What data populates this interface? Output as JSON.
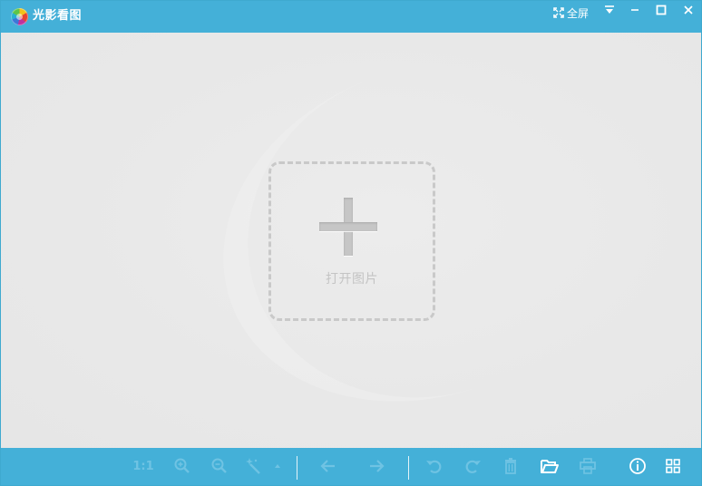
{
  "window": {
    "title": "光影看图"
  },
  "titlebar": {
    "fullscreen_label": "全屏",
    "icons": [
      "fullscreen-icon",
      "menu-icon",
      "minimize-icon",
      "maximize-icon",
      "close-icon"
    ]
  },
  "content": {
    "open_label": "打开图片",
    "open_icon": "plus-icon"
  },
  "toolbar": {
    "actual_size_label": "1:1",
    "icons": [
      "zoom-in-icon",
      "zoom-out-icon",
      "magic-wand-icon",
      "dropdown-arrow-icon",
      "prev-arrow-icon",
      "next-arrow-icon",
      "rotate-left-icon",
      "rotate-right-icon",
      "delete-icon",
      "open-folder-icon",
      "print-icon",
      "info-icon",
      "grid-icon"
    ]
  },
  "colors": {
    "titlebar_bg": "#44b0d8",
    "toolbar_bg": "#44b0d8",
    "content_bg": "#e9e9e9",
    "disabled_icon": "#6fc3e3",
    "active_icon": "#ffffff"
  }
}
